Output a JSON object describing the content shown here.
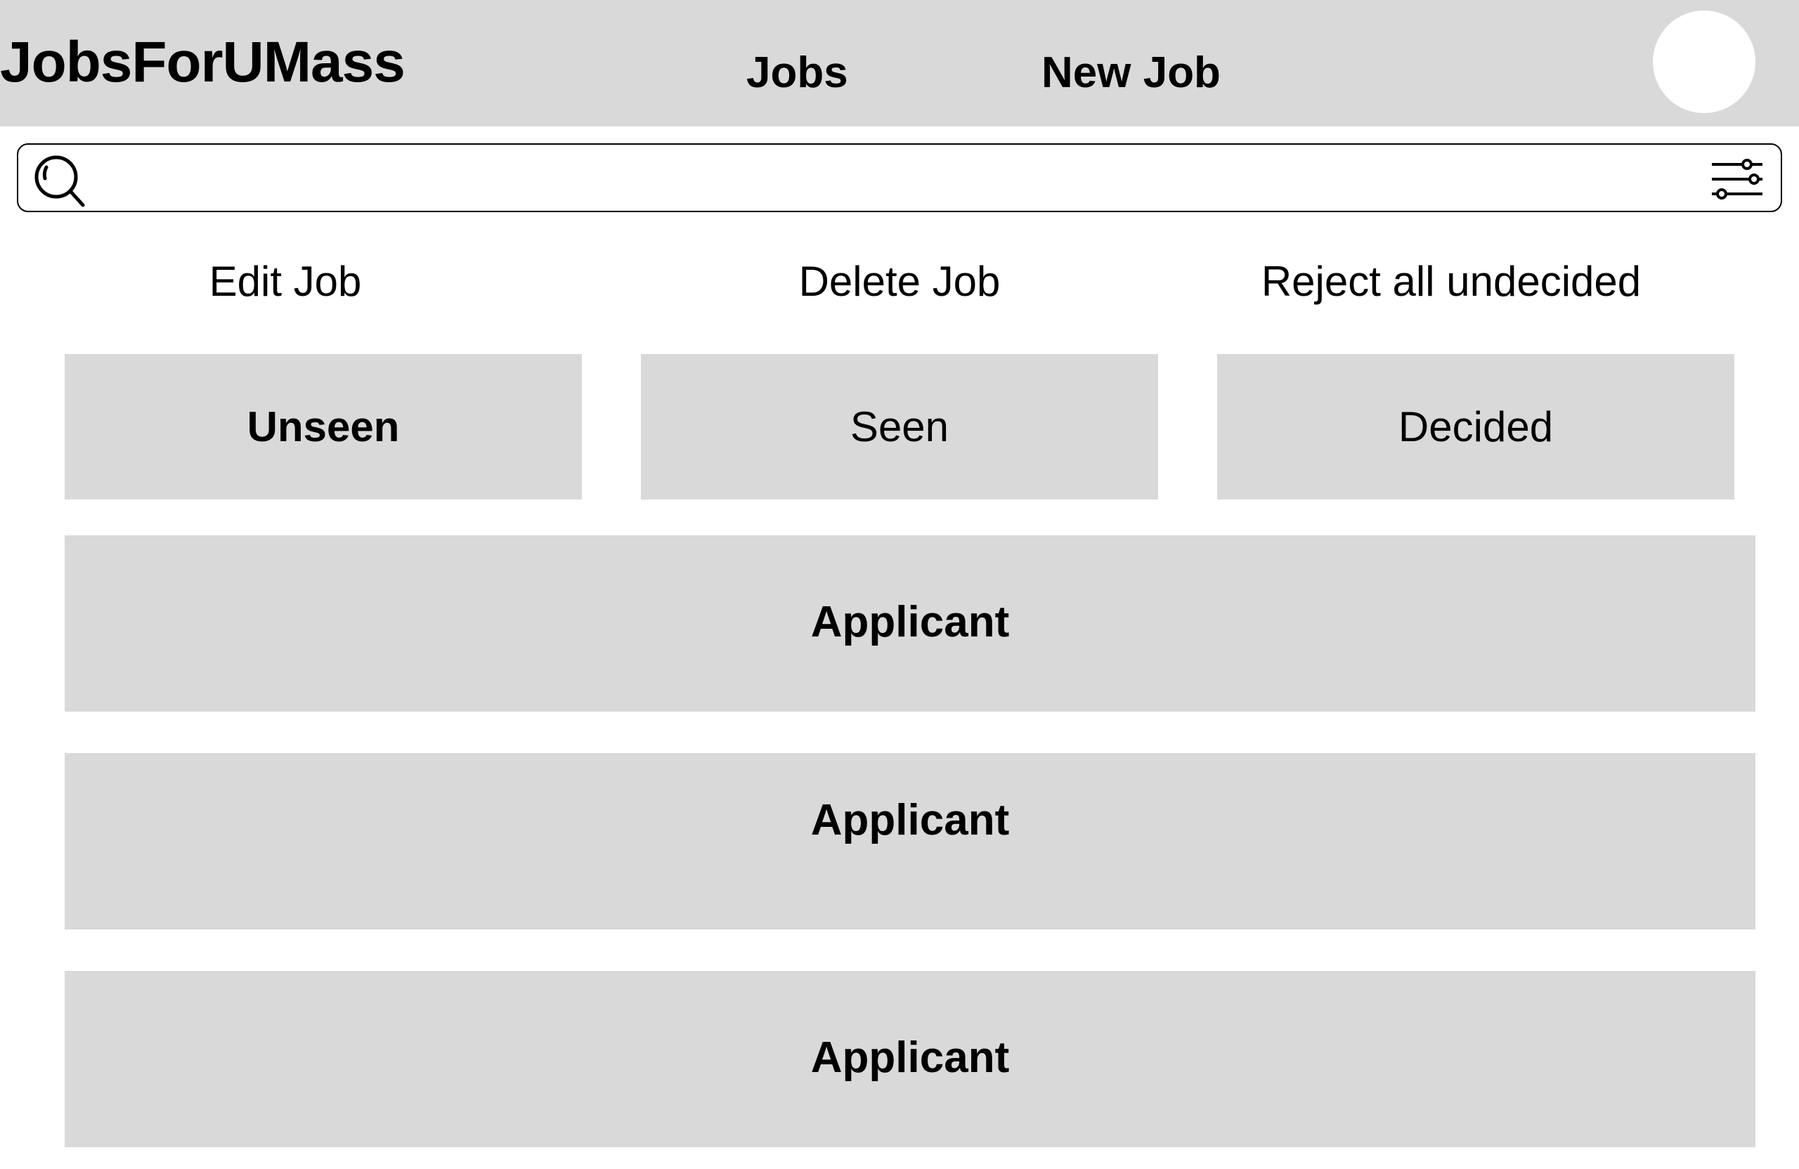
{
  "header": {
    "brand": "JobsForUMass",
    "nav": [
      {
        "label": "Jobs"
      },
      {
        "label": "New Job"
      }
    ]
  },
  "search": {
    "value": "",
    "placeholder": ""
  },
  "actions": {
    "edit": "Edit Job",
    "delete": "Delete Job",
    "reject_all": "Reject all undecided"
  },
  "tabs": [
    {
      "label": "Unseen",
      "active": true
    },
    {
      "label": "Seen",
      "active": false
    },
    {
      "label": "Decided",
      "active": false
    }
  ],
  "applicants": [
    {
      "label": "Applicant"
    },
    {
      "label": "Applicant"
    },
    {
      "label": "Applicant"
    }
  ],
  "colors": {
    "surface": "#d9d9d9",
    "background": "#ffffff",
    "text": "#000000"
  },
  "icons": [
    "search-icon",
    "filter-sliders-icon",
    "avatar"
  ]
}
